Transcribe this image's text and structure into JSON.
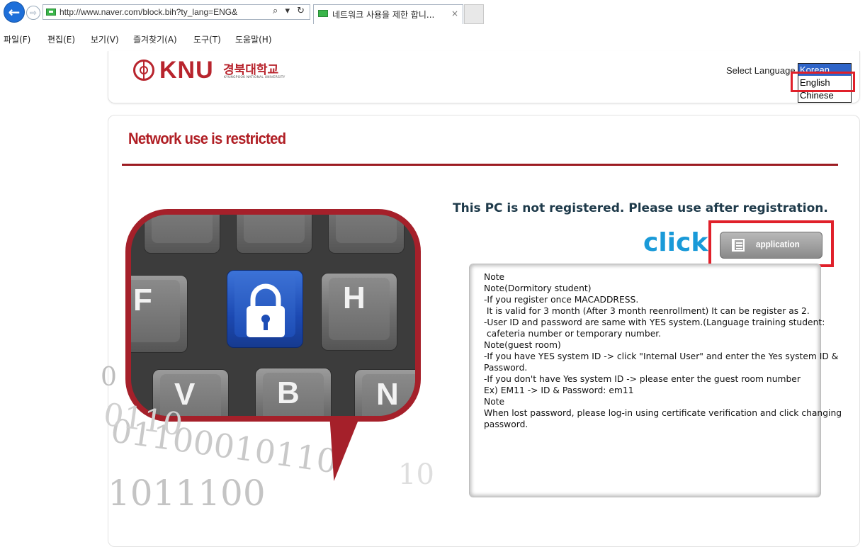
{
  "browser": {
    "url": "http://www.naver.com/block.bih?ty_lang=ENG&",
    "address_controls": "⌕ ▾ ↻",
    "tab_title": "네트워크 사용을 제한 합니...",
    "tab_close": "×",
    "back_icon": "back-arrow-icon",
    "forward_icon": "forward-arrow-icon"
  },
  "menubar": {
    "items": [
      "파일(F)",
      "편집(E)",
      "보기(V)",
      "즐겨찾기(A)",
      "도구(T)",
      "도움말(H)"
    ]
  },
  "header": {
    "logo_text": "KNU",
    "logo_korean": "경북대학교",
    "logo_sub": "KYUNGPOOK NATIONAL UNIVERSITY",
    "select_language_label": "Select Language",
    "language_options": [
      "Korean",
      "English",
      "Chinese"
    ],
    "selected_language": "Korean"
  },
  "main": {
    "title": "Network use is restricted",
    "notice": "This PC is not registered. Please use after registration.",
    "click_label": "click",
    "application_button": "application",
    "hero": {
      "keys": [
        "",
        "",
        "",
        "F",
        "",
        "H",
        "V",
        "B",
        "N"
      ],
      "binary_lines": [
        "0110",
        "0",
        "01100010110",
        "10",
        "1011100"
      ]
    },
    "notes": [
      "Note",
      "Note(Dormitory student)",
      "-If you register once MACADDRESS.",
      " It is valid for 3 month (After 3 month reenrollment) It can be register as 2.",
      "-User ID and password are same with YES system.(Language training student:",
      " cafeteria number or temporary number.",
      "Note(guest room)",
      "-If you have YES system ID -> click \"Internal User\" and enter the Yes system ID &",
      "Password.",
      "-If you don't have Yes system ID -> please enter the guest room number",
      "Ex) EM11 -> ID & Password: em11",
      "Note",
      "When lost password, please log-in using certificate verification and click changing",
      "password."
    ]
  },
  "colors": {
    "brand_red": "#b01e24",
    "highlight_red": "#e0202a",
    "click_blue": "#1a9ad8",
    "selected_option_blue": "#2e64c8"
  }
}
